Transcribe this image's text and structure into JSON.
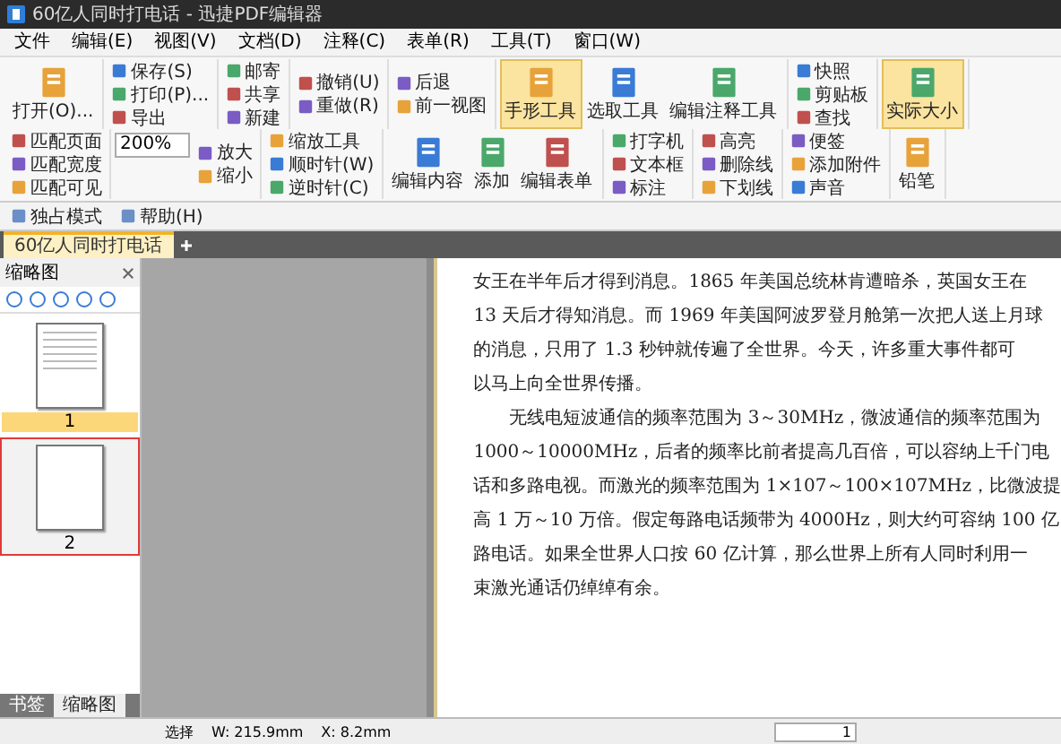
{
  "window": {
    "title": "60亿人同时打电话 - 迅捷PDF编辑器"
  },
  "menu": [
    {
      "label": "文件"
    },
    {
      "label": "编辑(E)"
    },
    {
      "label": "视图(V)"
    },
    {
      "label": "文档(D)"
    },
    {
      "label": "注释(C)"
    },
    {
      "label": "表单(R)"
    },
    {
      "label": "工具(T)"
    },
    {
      "label": "窗口(W)"
    }
  ],
  "ribbon": [
    {
      "kind": "large",
      "items": [
        {
          "label": "打开(O)...",
          "selected": false
        }
      ]
    },
    {
      "kind": "stack",
      "items": [
        {
          "label": "保存(S)"
        },
        {
          "label": "打印(P)..."
        },
        {
          "label": "导出"
        }
      ]
    },
    {
      "kind": "stack",
      "items": [
        {
          "label": "邮寄"
        },
        {
          "label": "共享"
        },
        {
          "label": "新建"
        }
      ]
    },
    {
      "kind": "stack",
      "items": [
        {
          "label": "撤销(U)"
        },
        {
          "label": "重做(R)"
        }
      ]
    },
    {
      "kind": "stack",
      "items": [
        {
          "label": "后退"
        },
        {
          "label": "前一视图"
        }
      ]
    },
    {
      "kind": "large",
      "items": [
        {
          "label": "手形工具",
          "selected": true
        },
        {
          "label": "选取工具",
          "selected": false
        },
        {
          "label": "编辑注释工具",
          "selected": false
        }
      ]
    },
    {
      "kind": "stack",
      "items": [
        {
          "label": "快照"
        },
        {
          "label": "剪贴板"
        },
        {
          "label": "查找"
        }
      ]
    },
    {
      "kind": "large",
      "items": [
        {
          "label": "实际大小",
          "selected": true
        }
      ]
    },
    {
      "kind": "stack",
      "items": [
        {
          "label": "匹配页面"
        },
        {
          "label": "匹配宽度"
        },
        {
          "label": "匹配可见"
        }
      ]
    },
    {
      "kind": "zoom",
      "value": "200%",
      "items": [
        {
          "label": "放大"
        },
        {
          "label": "缩小"
        }
      ]
    },
    {
      "kind": "stack",
      "items": [
        {
          "label": "缩放工具"
        },
        {
          "label": "顺时针(W)"
        },
        {
          "label": "逆时针(C)"
        }
      ]
    },
    {
      "kind": "large",
      "items": [
        {
          "label": "编辑内容",
          "selected": false
        },
        {
          "label": "添加",
          "selected": false
        },
        {
          "label": "编辑表单",
          "selected": false
        }
      ]
    },
    {
      "kind": "stack",
      "items": [
        {
          "label": "打字机"
        },
        {
          "label": "文本框"
        },
        {
          "label": "标注"
        }
      ]
    },
    {
      "kind": "stack",
      "items": [
        {
          "label": "高亮"
        },
        {
          "label": "删除线"
        },
        {
          "label": "下划线"
        }
      ]
    },
    {
      "kind": "stack",
      "items": [
        {
          "label": "便签"
        },
        {
          "label": "添加附件"
        },
        {
          "label": "声音"
        }
      ]
    },
    {
      "kind": "large",
      "items": [
        {
          "label": "铅笔",
          "selected": false
        }
      ]
    }
  ],
  "quick_bar": [
    {
      "label": "独占模式"
    },
    {
      "label": "帮助(H)"
    }
  ],
  "doc_tabs": [
    {
      "label": "60亿人同时打电话",
      "selected": true
    }
  ],
  "thumbnail_panel": {
    "title": "缩略图",
    "pages": [
      {
        "label": "1",
        "selected": true,
        "focused": false
      },
      {
        "label": "2",
        "selected": false,
        "focused": true
      }
    ],
    "tabs": [
      {
        "label": "书签",
        "selected": false
      },
      {
        "label": "缩略图",
        "selected": true
      }
    ]
  },
  "document": {
    "paragraphs": [
      [
        "女王在半年后才得到消息。1865 年美国总统林肯遭暗杀，英国女王在",
        "13 天后才得知消息。而 1969 年美国阿波罗登月舱第一次把人送上月球",
        "的消息，只用了 1.3 秒钟就传遍了全世界。今天，许多重大事件都可",
        "以马上向全世界传播。"
      ],
      [
        "无线电短波通信的频率范围为 3～30MHz，微波通信的频率范围为",
        "1000～10000MHz，后者的频率比前者提高几百倍，可以容纳上千门电",
        "话和多路电视。而激光的频率范围为 1×107～100×107MHz，比微波提",
        "高 1 万～10 万倍。假定每路电话频带为 4000Hz，则大约可容纳 100 亿",
        "路电话。如果全世界人口按 60 亿计算，那么世界上所有人同时利用一",
        "束激光通话仍绰绰有余。"
      ]
    ]
  },
  "status_bar": {
    "tool": "选择",
    "width": "W: 215.9mm",
    "x": "X: 8.2mm",
    "page": "1"
  }
}
